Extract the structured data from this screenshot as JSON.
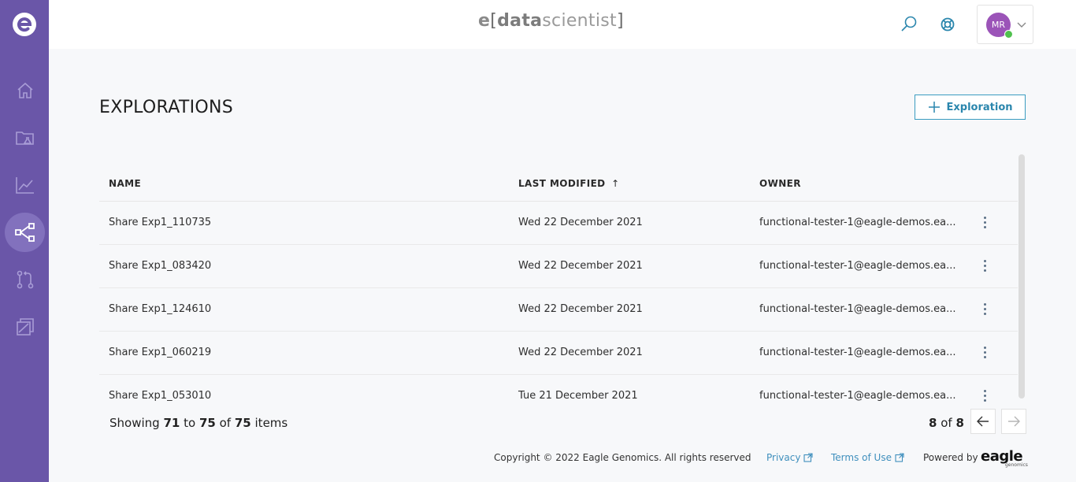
{
  "app": {
    "brand_prefix": "e",
    "brand_open": "[",
    "brand_data": "data",
    "brand_scientist": "scientist",
    "brand_close": "]",
    "user_initials": "MR"
  },
  "colors": {
    "sidebar": "#6a56a8",
    "accent": "#3a9bc0",
    "avatar": "#9b54b8",
    "online": "#50c14e"
  },
  "nav": [
    {
      "icon": "home-icon"
    },
    {
      "icon": "data-folder-icon"
    },
    {
      "icon": "analytics-chart-icon"
    },
    {
      "icon": "explorations-network-icon",
      "active": true
    },
    {
      "icon": "pull-request-icon"
    },
    {
      "icon": "reports-stack-icon"
    }
  ],
  "page": {
    "title": "EXPLORATIONS",
    "add_button": "Exploration"
  },
  "table": {
    "columns": {
      "name": "NAME",
      "modified": "LAST MODIFIED",
      "owner": "OWNER"
    },
    "sort_indicator": "↑",
    "rows": [
      {
        "name": "Share Exp1_110735",
        "modified": "Wed 22 December 2021",
        "owner": "functional-tester-1@eagle-demos.ea..."
      },
      {
        "name": "Share Exp1_083420",
        "modified": "Wed 22 December 2021",
        "owner": "functional-tester-1@eagle-demos.ea..."
      },
      {
        "name": "Share Exp1_124610",
        "modified": "Wed 22 December 2021",
        "owner": "functional-tester-1@eagle-demos.ea..."
      },
      {
        "name": "Share Exp1_060219",
        "modified": "Wed 22 December 2021",
        "owner": "functional-tester-1@eagle-demos.ea..."
      },
      {
        "name": "Share Exp1_053010",
        "modified": "Tue 21 December 2021",
        "owner": "functional-tester-1@eagle-demos.ea..."
      }
    ]
  },
  "pagination": {
    "showing": "Showing",
    "from": "71",
    "to_word": "to",
    "to": "75",
    "of_word": "of",
    "total": "75",
    "items_word": "items",
    "page": "8",
    "pages": "8"
  },
  "footer": {
    "copyright": "Copyright © 2022 Eagle Genomics. All rights reserved",
    "privacy": "Privacy",
    "terms": "Terms of Use",
    "powered_by": "Powered by",
    "eagle_logo": "eagle",
    "eagle_sub": "genomics"
  }
}
